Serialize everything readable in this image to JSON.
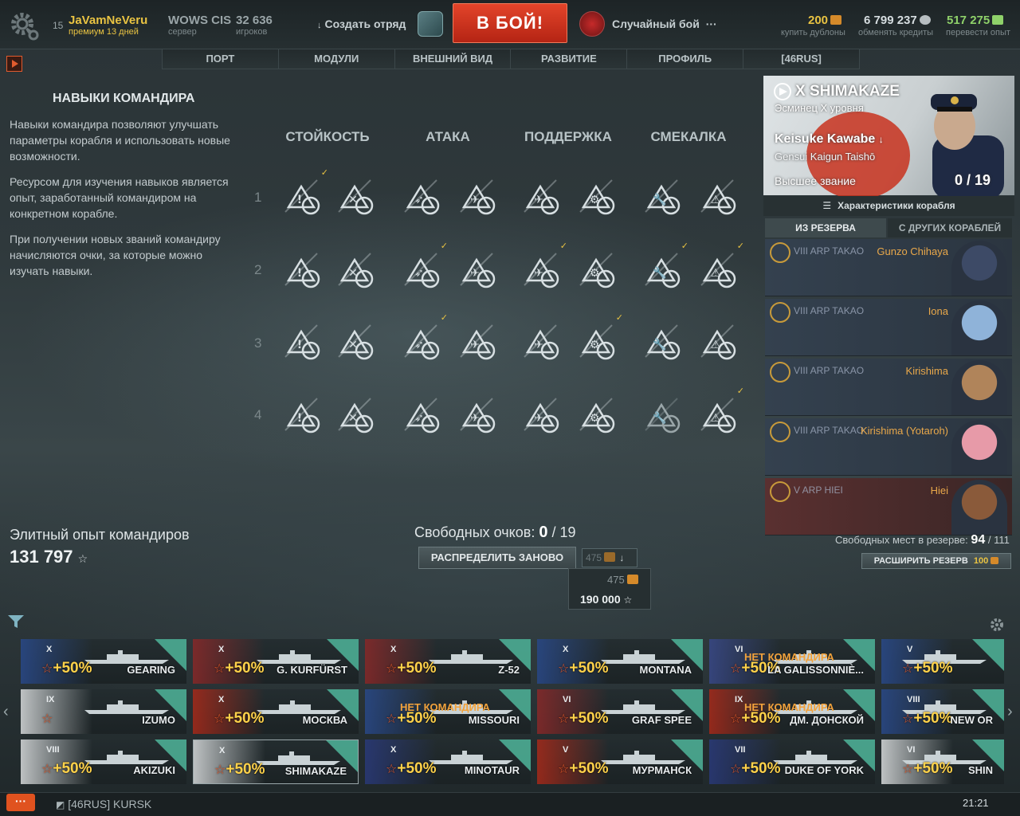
{
  "topbar": {
    "level": "15",
    "username": "JaVamNeVeru",
    "premium": "премиум 13 дней",
    "server_name": "WOWS CIS",
    "server_label": "сервер",
    "players_count": "32 636",
    "players_label": "игроков",
    "create_squad": "Создать отряд",
    "battle_button": "В БОЙ!",
    "battle_mode": "Случайный бой",
    "more": "···",
    "doubloons": "200",
    "doubloons_label": "купить дублоны",
    "credits": "6 799 237",
    "credits_label": "обменять кредиты",
    "free_xp": "517 275",
    "free_xp_label": "перевести опыт"
  },
  "nav": {
    "tabs": [
      "ПОРТ",
      "МОДУЛИ",
      "ВНЕШНИЙ ВИД",
      "РАЗВИТИЕ",
      "ПРОФИЛЬ",
      "[46RUS]"
    ]
  },
  "skills_panel": {
    "title": "НАВЫКИ КОМАНДИРА",
    "paragraphs": [
      "Навыки командира позволяют улучшать параметры корабля и использовать новые возможности.",
      "Ресурсом для изучения навыков является опыт, заработанный командиром на конкретном корабле.",
      "При получении новых званий командиру начисляются очки, за которые можно изучать навыки."
    ],
    "categories": [
      "СТОЙКОСТЬ",
      "АТАКА",
      "ПОДДЕРЖКА",
      "СМЕКАЛКА"
    ],
    "rows": [
      "1",
      "2",
      "3",
      "4"
    ]
  },
  "elite": {
    "label": "Элитный опыт командиров",
    "value": "131 797"
  },
  "free_points": {
    "label": "Свободных очков:",
    "value": "0",
    "total": "/ 19"
  },
  "reset": {
    "button": "РАСПРЕДЕЛИТЬ ЗАНОВО",
    "cost": "475",
    "popup_doubloons": "475",
    "popup_xp": "190 000"
  },
  "captain": {
    "tier": "X",
    "ship": "SHIMAKAZE",
    "ship_class": "Эсминец X уровня",
    "name": "Keisuke Kawabe",
    "rank": "Gensui Kaigun Taishō",
    "title": "Высшее звание",
    "points": "0 / 19",
    "stats_button": "Характеристики корабля",
    "tab_reserve": "ИЗ РЕЗЕРВА",
    "tab_other": "С ДРУГИХ КОРАБЛЕЙ"
  },
  "reserve": [
    {
      "ship": "VIII ARP TAKAO",
      "name": "Gunzo Chihaya",
      "color": "#3d4a66"
    },
    {
      "ship": "VIII ARP TAKAO",
      "name": "Iona",
      "color": "#8fb3d9"
    },
    {
      "ship": "VIII ARP TAKAO",
      "name": "Kirishima",
      "color": "#b0845a"
    },
    {
      "ship": "VIII ARP TAKAO",
      "name": "Kirishima (Yotaroh)",
      "color": "#e79aa8"
    },
    {
      "ship": "V ARP HIEI",
      "name": "Hiei",
      "color": "#8a5a3a"
    }
  ],
  "reserve_info": {
    "label": "Свободных мест в резерве:",
    "value": "94",
    "total": "/ 111",
    "expand_button": "РАСШИРИТЬ РЕЗЕРВ",
    "expand_cost": "100"
  },
  "ships": [
    {
      "tier": "X",
      "name": "GEARING",
      "bonus": "+50%",
      "nocmd": "",
      "flag": "#2a4a8a"
    },
    {
      "tier": "X",
      "name": "G. KURFÜRST",
      "bonus": "+50%",
      "nocmd": "",
      "flag": "#8a2a2a"
    },
    {
      "tier": "X",
      "name": "Z-52",
      "bonus": "+50%",
      "nocmd": "",
      "flag": "#8a2a2a"
    },
    {
      "tier": "X",
      "name": "MONTANA",
      "bonus": "+50%",
      "nocmd": "",
      "flag": "#2a4a8a"
    },
    {
      "tier": "VI",
      "name": "LA GALISSONNIÈ...",
      "bonus": "+50%",
      "nocmd": "НЕТ КОМАНДИРА",
      "flag": "#3a4a8a"
    },
    {
      "tier": "V",
      "name": "",
      "bonus": "+50%",
      "nocmd": "",
      "flag": "#2a4a8a"
    },
    {
      "tier": "IX",
      "name": "IZUMO",
      "bonus": "",
      "nocmd": "",
      "flag": "#d9dcdd"
    },
    {
      "tier": "X",
      "name": "МОСКВА",
      "bonus": "+50%",
      "nocmd": "",
      "flag": "#a82a1a"
    },
    {
      "tier": "",
      "name": "MISSOURI",
      "bonus": "+50%",
      "nocmd": "НЕТ КОМАНДИРА",
      "flag": "#2a4a8a"
    },
    {
      "tier": "VI",
      "name": "GRAF SPEE",
      "bonus": "+50%",
      "nocmd": "",
      "flag": "#8a2a2a"
    },
    {
      "tier": "IX",
      "name": "ДМ. ДОНСКОЙ",
      "bonus": "+50%",
      "nocmd": "НЕТ КОМАНДИРА",
      "flag": "#a82a1a"
    },
    {
      "tier": "VIII",
      "name": "NEW OR",
      "bonus": "+50%",
      "nocmd": "",
      "flag": "#2a4a8a"
    },
    {
      "tier": "VIII",
      "name": "AKIZUKI",
      "bonus": "+50%",
      "nocmd": "",
      "flag": "#d9dcdd"
    },
    {
      "tier": "X",
      "name": "SHIMAKAZE",
      "bonus": "+50%",
      "nocmd": "",
      "flag": "#d9dcdd"
    },
    {
      "tier": "X",
      "name": "MINOTAUR",
      "bonus": "+50%",
      "nocmd": "",
      "flag": "#2a3a7a"
    },
    {
      "tier": "V",
      "name": "МУРМАНСК",
      "bonus": "+50%",
      "nocmd": "",
      "flag": "#a82a1a"
    },
    {
      "tier": "VII",
      "name": "DUKE OF YORK",
      "bonus": "+50%",
      "nocmd": "",
      "flag": "#2a3a7a"
    },
    {
      "tier": "VI",
      "name": "SHIN",
      "bonus": "+50%",
      "nocmd": "",
      "flag": "#d9dcdd"
    }
  ],
  "status_bar": {
    "chat": "···",
    "clan": "[46RUS] KURSK",
    "time": "21:21"
  }
}
